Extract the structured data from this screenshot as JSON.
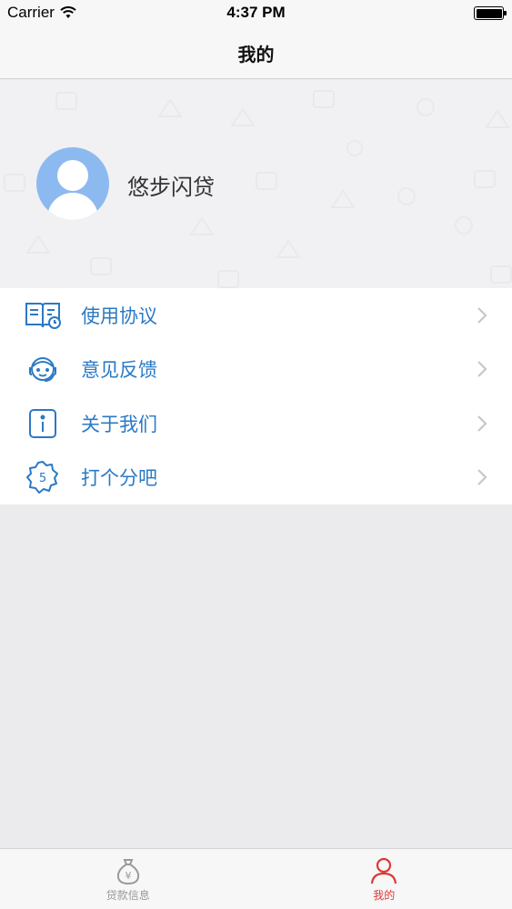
{
  "status_bar": {
    "carrier": "Carrier",
    "time": "4:37 PM"
  },
  "nav": {
    "title": "我的"
  },
  "profile": {
    "name": "悠步闪贷",
    "avatar_color": "#8cbaf0"
  },
  "menu": {
    "items": [
      {
        "label": "使用协议",
        "icon": "book-icon"
      },
      {
        "label": "意见反馈",
        "icon": "headset-agent-icon"
      },
      {
        "label": "关于我们",
        "icon": "info-icon"
      },
      {
        "label": "打个分吧",
        "icon": "rating-badge-icon",
        "icon_text": "5"
      }
    ]
  },
  "tab_bar": {
    "tabs": [
      {
        "label": "贷款信息",
        "icon": "money-bag-icon",
        "icon_text": "¥",
        "selected": false
      },
      {
        "label": "我的",
        "icon": "person-icon",
        "selected": true
      }
    ]
  },
  "colors": {
    "accent": "#2b79c4",
    "tab_active": "#d93a36",
    "tab_inactive": "#9a9a9a"
  }
}
